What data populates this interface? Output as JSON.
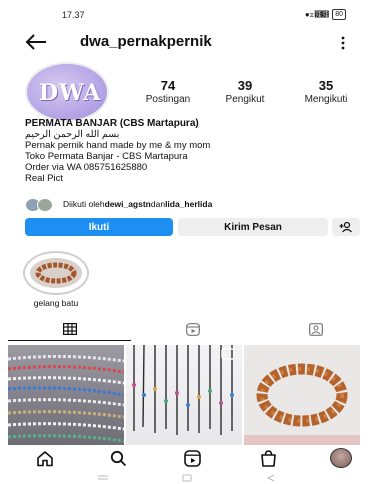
{
  "status_bar": {
    "time": "17.37",
    "icons_text": "● ⧖ ๻๻",
    "battery": "80"
  },
  "header": {
    "username": "dwa_pernakpernik",
    "back_icon": "arrow-left-icon",
    "more_icon": "more-vertical-icon"
  },
  "profile": {
    "avatar_text": "DWA",
    "stats": [
      {
        "value": "74",
        "label": "Postingan"
      },
      {
        "value": "39",
        "label": "Pengikut"
      },
      {
        "value": "35",
        "label": "Mengikuti"
      }
    ]
  },
  "bio": {
    "name": "PERMATA BANJAR (CBS Martapura)",
    "lines": [
      "بسم الله الرحمن الرحيم",
      "Pernak pernik hand made by me & my mom",
      "Toko Permata Banjar - CBS Martapura",
      "Order via WA 085751625880",
      "Real Pict"
    ]
  },
  "followed_by": {
    "prefix": "Diikuti oleh ",
    "user1": "dewi_agstn",
    "conj": " dan ",
    "user2": "lida_herlida"
  },
  "actions": {
    "follow": "Ikuti",
    "message": "Kirim Pesan"
  },
  "highlights": [
    {
      "label": "gelang batu"
    }
  ],
  "tabs": [
    "grid-icon",
    "reels-icon",
    "tagged-icon"
  ],
  "bottom_nav": [
    "home-icon",
    "search-icon",
    "reels-icon",
    "shop-icon",
    "profile-avatar"
  ],
  "colors": {
    "accent": "#1d8ff2",
    "button_gray": "#eeeeee"
  }
}
